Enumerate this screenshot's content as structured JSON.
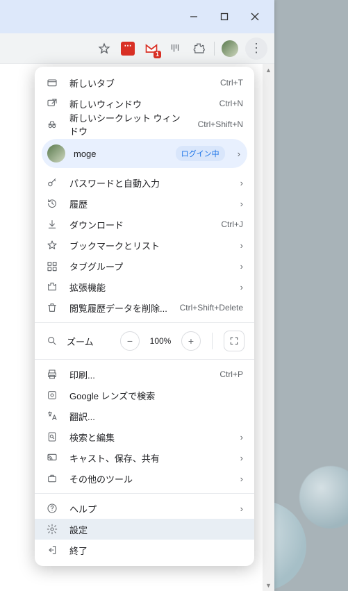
{
  "toolbar": {
    "gmail_badge": "1"
  },
  "profile": {
    "name": "moge",
    "badge": "ログイン中"
  },
  "menu": {
    "new_tab": {
      "label": "新しいタブ",
      "shortcut": "Ctrl+T"
    },
    "new_window": {
      "label": "新しいウィンドウ",
      "shortcut": "Ctrl+N"
    },
    "incognito": {
      "label": "新しいシークレット ウィンドウ",
      "shortcut": "Ctrl+Shift+N"
    },
    "passwords": {
      "label": "パスワードと自動入力"
    },
    "history": {
      "label": "履歴"
    },
    "downloads": {
      "label": "ダウンロード",
      "shortcut": "Ctrl+J"
    },
    "bookmarks": {
      "label": "ブックマークとリスト"
    },
    "tab_groups": {
      "label": "タブグループ"
    },
    "extensions": {
      "label": "拡張機能"
    },
    "clear_data": {
      "label": "閲覧履歴データを削除...",
      "shortcut": "Ctrl+Shift+Delete"
    },
    "zoom": {
      "label": "ズーム",
      "value": "100%"
    },
    "print": {
      "label": "印刷...",
      "shortcut": "Ctrl+P"
    },
    "lens": {
      "label": "Google レンズで検索"
    },
    "translate": {
      "label": "翻訳..."
    },
    "find": {
      "label": "検索と編集"
    },
    "cast": {
      "label": "キャスト、保存、共有"
    },
    "more_tools": {
      "label": "その他のツール"
    },
    "help": {
      "label": "ヘルプ"
    },
    "settings": {
      "label": "設定"
    },
    "exit": {
      "label": "終了"
    }
  }
}
